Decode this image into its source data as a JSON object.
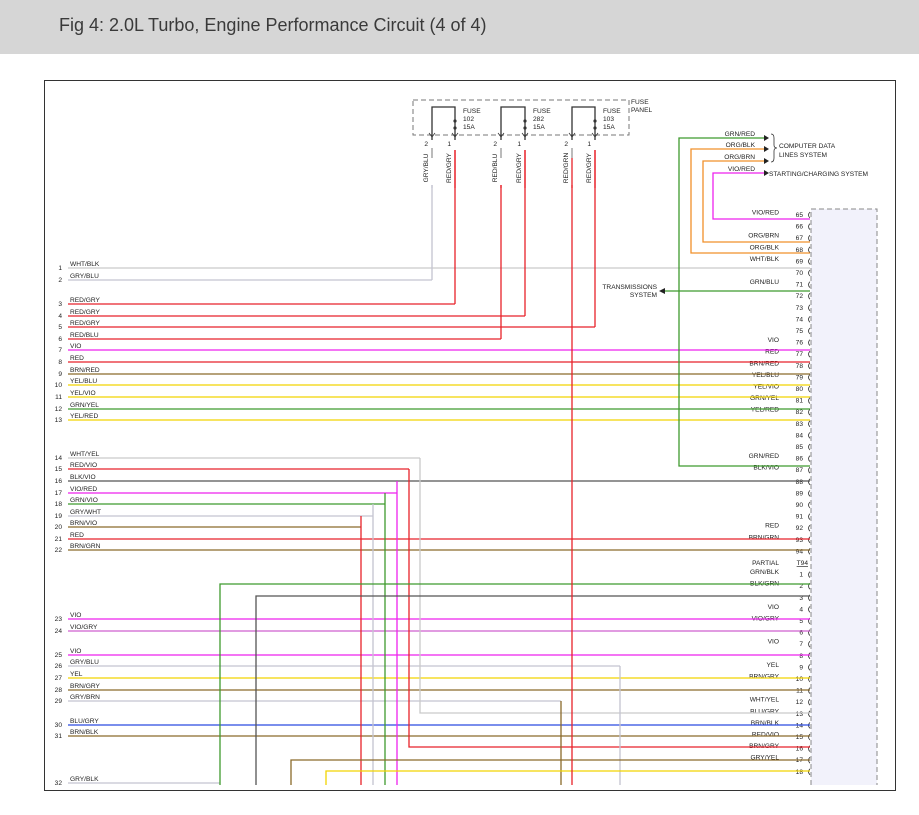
{
  "header": {
    "title": "Fig 4: 2.0L Turbo, Engine Performance Circuit (4 of 4)"
  },
  "colors": {
    "WHT": "#c9c9c9",
    "GRY": "#c4c4d0",
    "RED": "#e8222a",
    "VIO": "#ee22ee",
    "GRN": "#3f9a2e",
    "YEL": "#f2d400",
    "BRN": "#8a6a2a",
    "BLK": "#555555",
    "BLU": "#2a4ae0",
    "ORG": "#f0902a",
    "VIOGRY": "#cf5fcf"
  },
  "fuse_panel": {
    "label": "FUSE PANEL",
    "fuses": [
      {
        "name": "FUSE",
        "number": "102",
        "rating": "15A",
        "pin_in": "2",
        "pin_out": "1",
        "wire_in": "GRY/BLU",
        "wire_out": "RED/GRY"
      },
      {
        "name": "FUSE",
        "number": "282",
        "rating": "15A",
        "pin_in": "2",
        "pin_out": "1",
        "wire_in": "RED/BLU",
        "wire_out": "RED/GRY"
      },
      {
        "name": "FUSE",
        "number": "103",
        "rating": "15A",
        "pin_in": "2",
        "pin_out": "1",
        "wire_in": "RED/GRN",
        "wire_out": "RED/GRY"
      }
    ]
  },
  "system_labels": {
    "computer_data": [
      "COMPUTER DATA",
      "LINES SYSTEM"
    ],
    "starting_charging": "STARTING/CHARGING SYSTEM",
    "transmissions": [
      "TRANSMISSIONS",
      "SYSTEM"
    ]
  },
  "top_wires": [
    {
      "label": "GRN/RED",
      "color": "GRN"
    },
    {
      "label": "ORG/BLK",
      "color": "ORG"
    },
    {
      "label": "ORG/BRN",
      "color": "ORG"
    },
    {
      "label": "VIO/RED",
      "color": "VIO"
    }
  ],
  "left_wires": [
    {
      "num": "1",
      "label": "WHT/BLK",
      "color": "WHT"
    },
    {
      "num": "2",
      "label": "GRY/BLU",
      "color": "GRY"
    },
    {
      "num": "3",
      "label": "RED/GRY",
      "color": "RED"
    },
    {
      "num": "4",
      "label": "RED/GRY",
      "color": "RED"
    },
    {
      "num": "5",
      "label": "RED/GRY",
      "color": "RED"
    },
    {
      "num": "6",
      "label": "RED/BLU",
      "color": "RED"
    },
    {
      "num": "7",
      "label": "VIO",
      "color": "VIO"
    },
    {
      "num": "8",
      "label": "RED",
      "color": "RED"
    },
    {
      "num": "9",
      "label": "BRN/RED",
      "color": "BRN"
    },
    {
      "num": "10",
      "label": "YEL/BLU",
      "color": "YEL"
    },
    {
      "num": "11",
      "label": "YEL/VIO",
      "color": "YEL"
    },
    {
      "num": "12",
      "label": "GRN/YEL",
      "color": "GRN"
    },
    {
      "num": "13",
      "label": "YEL/RED",
      "color": "YEL"
    },
    {
      "num": "14",
      "label": "WHT/YEL",
      "color": "WHT"
    },
    {
      "num": "15",
      "label": "RED/VIO",
      "color": "RED"
    },
    {
      "num": "16",
      "label": "BLK/VIO",
      "color": "BLK"
    },
    {
      "num": "17",
      "label": "VIO/RED",
      "color": "VIO"
    },
    {
      "num": "18",
      "label": "GRN/VIO",
      "color": "GRN"
    },
    {
      "num": "19",
      "label": "GRY/WHT",
      "color": "GRY"
    },
    {
      "num": "20",
      "label": "BRN/VIO",
      "color": "BRN"
    },
    {
      "num": "21",
      "label": "RED",
      "color": "RED"
    },
    {
      "num": "22",
      "label": "BRN/GRN",
      "color": "BRN"
    },
    {
      "num": "23",
      "label": "VIO",
      "color": "VIO"
    },
    {
      "num": "24",
      "label": "VIO/GRY",
      "color": "VIOGRY"
    },
    {
      "num": "25",
      "label": "VIO",
      "color": "VIO"
    },
    {
      "num": "26",
      "label": "GRY/BLU",
      "color": "GRY"
    },
    {
      "num": "27",
      "label": "YEL",
      "color": "YEL"
    },
    {
      "num": "28",
      "label": "BRN/GRY",
      "color": "BRN"
    },
    {
      "num": "29",
      "label": "GRY/BRN",
      "color": "GRY"
    },
    {
      "num": "30",
      "label": "BLU/GRY",
      "color": "BLU"
    },
    {
      "num": "31",
      "label": "BRN/BLK",
      "color": "BRN"
    },
    {
      "num": "32",
      "label": "GRY/BLK",
      "color": "GRY"
    }
  ],
  "connector_rows": [
    {
      "pin": "65",
      "label": "VIO/RED"
    },
    {
      "pin": "66",
      "label": ""
    },
    {
      "pin": "67",
      "label": "ORG/BRN"
    },
    {
      "pin": "68",
      "label": "ORG/BLK"
    },
    {
      "pin": "69",
      "label": "WHT/BLK"
    },
    {
      "pin": "70",
      "label": ""
    },
    {
      "pin": "71",
      "label": "GRN/BLU"
    },
    {
      "pin": "72",
      "label": ""
    },
    {
      "pin": "73",
      "label": ""
    },
    {
      "pin": "74",
      "label": ""
    },
    {
      "pin": "75",
      "label": ""
    },
    {
      "pin": "76",
      "label": "VIO"
    },
    {
      "pin": "77",
      "label": "RED"
    },
    {
      "pin": "78",
      "label": "BRN/RED"
    },
    {
      "pin": "79",
      "label": "YEL/BLU"
    },
    {
      "pin": "80",
      "label": "YEL/VIO"
    },
    {
      "pin": "81",
      "label": "GRN/YEL"
    },
    {
      "pin": "82",
      "label": "YEL/RED"
    },
    {
      "pin": "83",
      "label": ""
    },
    {
      "pin": "84",
      "label": ""
    },
    {
      "pin": "85",
      "label": ""
    },
    {
      "pin": "86",
      "label": "GRN/RED"
    },
    {
      "pin": "87",
      "label": "BLK/VIO"
    },
    {
      "pin": "88",
      "label": ""
    },
    {
      "pin": "89",
      "label": ""
    },
    {
      "pin": "90",
      "label": ""
    },
    {
      "pin": "91",
      "label": ""
    },
    {
      "pin": "92",
      "label": "RED"
    },
    {
      "pin": "93",
      "label": "BRN/GRN"
    },
    {
      "pin": "94",
      "label": ""
    },
    {
      "pin": "T94",
      "label": "PARTIAL"
    },
    {
      "pin": "1",
      "label": "GRN/BLK"
    },
    {
      "pin": "2",
      "label": "BLK/GRN"
    },
    {
      "pin": "3",
      "label": ""
    },
    {
      "pin": "4",
      "label": "VIO"
    },
    {
      "pin": "5",
      "label": "VIO/GRY"
    },
    {
      "pin": "6",
      "label": ""
    },
    {
      "pin": "7",
      "label": "VIO"
    },
    {
      "pin": "8",
      "label": ""
    },
    {
      "pin": "9",
      "label": "YEL"
    },
    {
      "pin": "10",
      "label": "BRN/GRY"
    },
    {
      "pin": "11",
      "label": ""
    },
    {
      "pin": "12",
      "label": "WHT/YEL"
    },
    {
      "pin": "13",
      "label": "BLU/GRY"
    },
    {
      "pin": "14",
      "label": "BRN/BLK"
    },
    {
      "pin": "15",
      "label": "RED/VIO"
    },
    {
      "pin": "16",
      "label": "BRN/GRY"
    },
    {
      "pin": "17",
      "label": "GRY/YEL"
    },
    {
      "pin": "18",
      "label": ""
    }
  ]
}
